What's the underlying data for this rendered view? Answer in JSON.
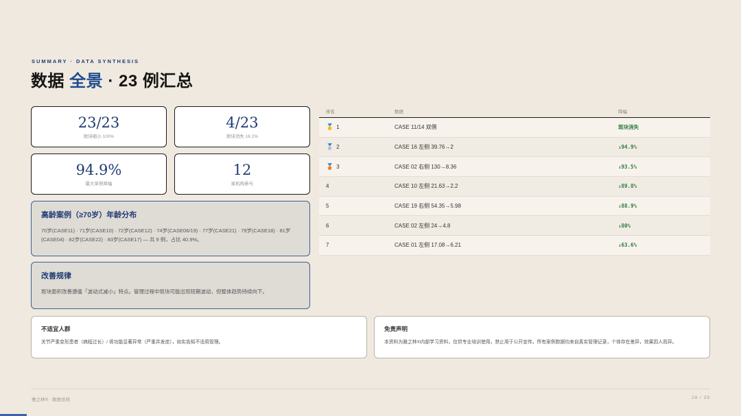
{
  "header": {
    "eyebrow": "SUMMARY · DATA SYNTHESIS",
    "title_prefix": "数据 ",
    "title_accent": "全景",
    "title_suffix": " · 23 例汇总"
  },
  "stats": [
    {
      "value": "23/23",
      "label": "斑块缩小 100%"
    },
    {
      "value": "4/23",
      "label": "斑块消失 18.2%"
    },
    {
      "value": "94.9%",
      "label": "最大单例降幅"
    },
    {
      "value": "12",
      "label": "家机构参与"
    }
  ],
  "elderly": {
    "heading": "高龄案例（≥70岁）年龄分布",
    "body": "70岁(CASE11) · 71岁(CASE10) · 72岁(CASE12) · 74岁(CASE06/19) · 77岁(CASE21) · 79岁(CASE18) · 81岁(CASE04) · 82岁(CASE22) · 83岁(CASE17) — 共 9 例，占比 40.9%。"
  },
  "pattern": {
    "heading": "改善规律",
    "body": "斑块面积改善遵循「波动式减小」特点。管理过程中斑块可能出现短期波动，但整体趋势持续向下。"
  },
  "table": {
    "headers": [
      "排名",
      "数据",
      "降幅"
    ],
    "rows": [
      {
        "medal": "🥇",
        "rank": "1",
        "data": "CASE 11/14 双侧",
        "drop": "斑块消失"
      },
      {
        "medal": "🥈",
        "rank": "2",
        "data": "CASE 16 左侧 39.76→2",
        "drop": "↓94.9%"
      },
      {
        "medal": "🥉",
        "rank": "3",
        "data": "CASE 02 右侧 130→8.36",
        "drop": "↓93.5%"
      },
      {
        "medal": "",
        "rank": "4",
        "data": "CASE 10 左侧 21.63→2.2",
        "drop": "↓89.8%"
      },
      {
        "medal": "",
        "rank": "5",
        "data": "CASE 19 右侧 54.35→5.98",
        "drop": "↓88.9%"
      },
      {
        "medal": "",
        "rank": "6",
        "data": "CASE 02 左侧 24→4.8",
        "drop": "↓80%"
      },
      {
        "medal": "",
        "rank": "7",
        "data": "CASE 01 左侧 17.08→6.21",
        "drop": "↓63.6%"
      }
    ]
  },
  "notes": {
    "unsuitable_heading": "不适宜人群",
    "unsuitable_body": "关节严重变形患者（病程过长）/ 肾功能显著异常（严重并发症），如实告知不适用管理。",
    "disclaimer_heading": "免责声明",
    "disclaimer_body": "本资料为雅之林®内部学习资料，仅供专业培训使用，禁止用于公开宣传。所有案例数据均来自真实管理记录，个体存在差异，效果因人而异。"
  },
  "footer": {
    "left": "雅之林® · 数据总结",
    "right": "28 / 28",
    "progress": 0.036
  },
  "colors": {
    "accent": "#1f4c8f",
    "positive": "#2e7a3e",
    "background": "#efe9df"
  }
}
